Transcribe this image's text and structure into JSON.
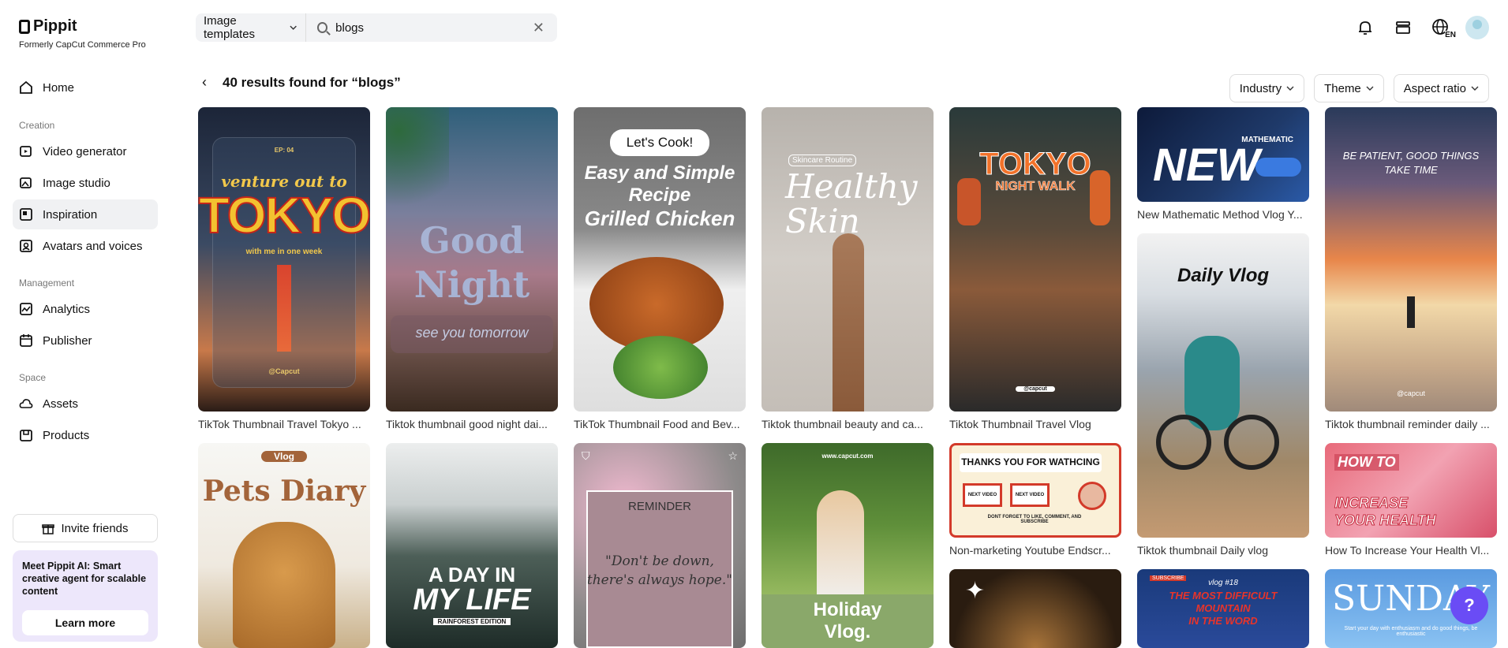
{
  "brand": {
    "name": "Pippit",
    "subtitle": "Formerly CapCut Commerce Pro"
  },
  "nav": {
    "home": "Home",
    "creation_label": "Creation",
    "video_generator": "Video generator",
    "image_studio": "Image studio",
    "inspiration": "Inspiration",
    "avatars": "Avatars and voices",
    "management_label": "Management",
    "analytics": "Analytics",
    "publisher": "Publisher",
    "space_label": "Space",
    "assets": "Assets",
    "products": "Products"
  },
  "invite": "Invite friends",
  "promo": {
    "text": "Meet Pippit AI: Smart creative agent for scalable content",
    "button": "Learn more"
  },
  "search": {
    "type": "Image templates",
    "value": "blogs"
  },
  "header": {
    "lang": "EN"
  },
  "results": {
    "title": "40 results found for “blogs”"
  },
  "filters": {
    "industry": "Industry",
    "theme": "Theme",
    "aspect": "Aspect ratio"
  },
  "cards": {
    "c1": {
      "title": "TikTok Thumbnail Travel Tokyo ...",
      "ep": "EP: 04",
      "t1": "venture out to",
      "t2": "TOKYO",
      "t3": "with me in one week",
      "tag": "@Capcut"
    },
    "c2": {
      "title": "Tiktok thumbnail good night dai...",
      "t1": "Good",
      "t2": "Night",
      "t3": "see you tomorrow"
    },
    "c3": {
      "title": "TikTok Thumbnail Food and Bev...",
      "t0": "Let's Cook!",
      "t1": "Easy and Simple",
      "t2": "Recipe",
      "t3": "Grilled Chicken"
    },
    "c4": {
      "title": "Tiktok thumbnail beauty and ca...",
      "t0": "Skincare Routine",
      "t1": "Healthy",
      "t2": "Skin"
    },
    "c5": {
      "title": "Tiktok Thumbnail Travel Vlog",
      "t1": "TOKYO",
      "t2": "NIGHT WALK",
      "tag": "@capcut"
    },
    "c6": {
      "title": "New Mathematic Method Vlog Y...",
      "t0": "MATHEMATIC",
      "t1": "NEW"
    },
    "c7": {
      "title": "Tiktok thumbnail reminder daily ...",
      "t1": "BE PATIENT, GOOD THINGS",
      "t2": "TAKE TIME",
      "tag": "@capcut"
    },
    "c8": {
      "t0": "Vlog",
      "t1": "Pets Diary"
    },
    "c9": {
      "t1": "A DAY IN",
      "t2": "MY LIFE",
      "t3": "RAINFOREST EDITION"
    },
    "c10": {
      "t1": "REMINDER",
      "t2": "\"Don't be down,",
      "t3": "there's always hope.\""
    },
    "c11": {
      "t0": "www.capcut.com",
      "t1": "Holiday",
      "t2": "Vlog."
    },
    "c12": {
      "title": "Non-marketing Youtube Endscr...",
      "t1": "THANKS YOU FOR WATHCING",
      "t2": "NEXT VIDEO",
      "t3": "NEXT VIDEO",
      "t4": "DONT FORGET TO LIKE, COMMENT, AND SUBSCRIBE"
    },
    "c13": {
      "title": "Tiktok thumbnail Daily vlog",
      "t1": "Daily Vlog"
    },
    "c14": {
      "title": "How To Increase Your Health Vl...",
      "t1": "HOW TO",
      "t2": "INCREASE",
      "t3": "YOUR HEALTH"
    },
    "c15": {},
    "c16": {
      "t0": "SUBSCRIBE",
      "t1": "vlog #18",
      "t2": "THE MOST DIFFICULT",
      "t3": "MOUNTAIN",
      "t4": "IN THE WORD"
    },
    "c17": {
      "t1": "SUNDAY",
      "t2": "Start your day with enthusiasm and do good things, be enthusiastic"
    }
  }
}
